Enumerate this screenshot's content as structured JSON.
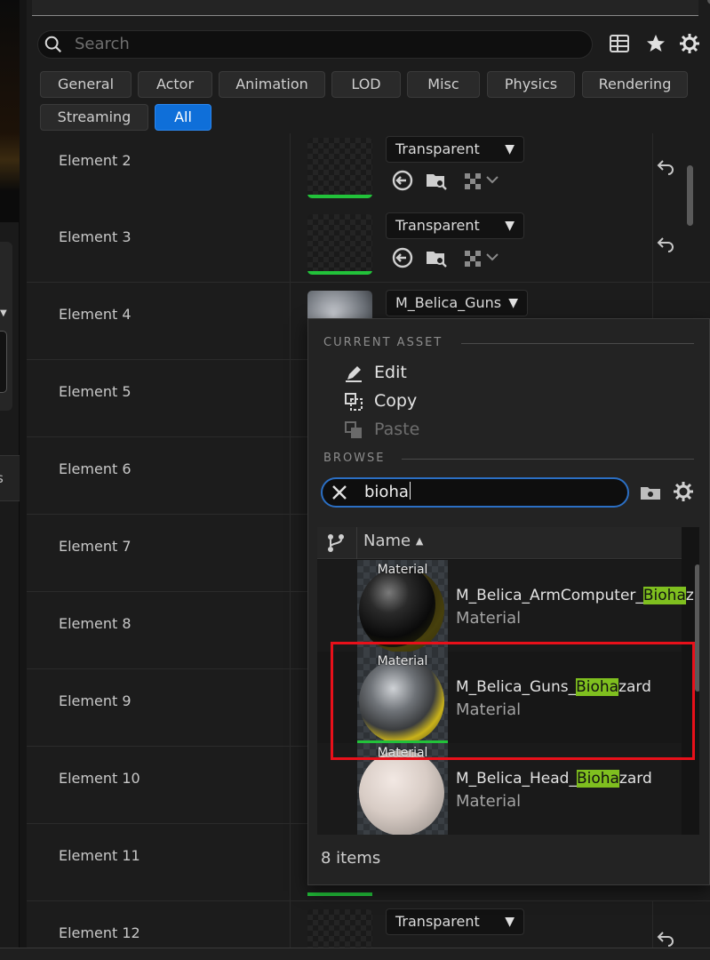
{
  "search": {
    "placeholder": "Search"
  },
  "toolbar": {
    "icons": [
      "table-view-icon",
      "star-icon",
      "gear-icon"
    ]
  },
  "filters": [
    {
      "label": "General"
    },
    {
      "label": "Actor"
    },
    {
      "label": "Animation"
    },
    {
      "label": "LOD"
    },
    {
      "label": "Misc"
    },
    {
      "label": "Physics"
    },
    {
      "label": "Rendering"
    },
    {
      "label": "Streaming"
    },
    {
      "label": "All",
      "active": true
    }
  ],
  "elements": [
    {
      "label": "Element 2",
      "material": "Transparent"
    },
    {
      "label": "Element 3",
      "material": "Transparent"
    },
    {
      "label": "Element 4",
      "material": "M_Belica_Guns"
    },
    {
      "label": "Element 5"
    },
    {
      "label": "Element 6"
    },
    {
      "label": "Element 7"
    },
    {
      "label": "Element 8"
    },
    {
      "label": "Element 9"
    },
    {
      "label": "Element 10"
    },
    {
      "label": "Element 11"
    },
    {
      "label": "Element 12",
      "material": "Transparent"
    }
  ],
  "side_tab": {
    "label": "s"
  },
  "popup": {
    "current_asset_header": "CURRENT ASSET",
    "edit_label": "Edit",
    "copy_label": "Copy",
    "paste_label": "Paste",
    "browse_header": "BROWSE",
    "search_value": "bioha",
    "column_name": "Name",
    "sort_indicator": "▲",
    "assets": [
      {
        "thumb_label": "Material",
        "name_prefix": "M_Belica_ArmComputer_",
        "name_match": "Bioha",
        "name_suffix": "z",
        "type": "Material"
      },
      {
        "thumb_label": "Material",
        "name_prefix": "M_Belica_Guns_",
        "name_match": "Bioha",
        "name_suffix": "zard",
        "type": "Material"
      },
      {
        "thumb_label": "Material",
        "name_prefix": "M_Belica_Head_",
        "name_match": "Bioha",
        "name_suffix": "zard",
        "type": "Material"
      }
    ],
    "item_count": "8 items"
  },
  "colors": {
    "accent": "#0f6fd9",
    "highlight": "#7fbf1f",
    "selection_box": "#e8101a",
    "green_bar": "#22c23a"
  }
}
